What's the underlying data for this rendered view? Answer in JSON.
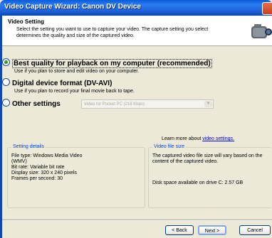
{
  "window": {
    "title": "Video Capture Wizard: Canon DV Device"
  },
  "header": {
    "title": "Video Setting",
    "description": "Select the setting you want to use to capture your video. The capture setting you select determines the quality and size of the captured video."
  },
  "options": [
    {
      "label": "Best quality for playback on my computer (recommended)",
      "description": "Use if you plan to store and edit video on your computer.",
      "selected": true
    },
    {
      "label": "Digital device format (DV-AVI)",
      "description": "Use if you plan to record your final movie back to tape.",
      "selected": false
    },
    {
      "label": "Other settings",
      "selected": false
    }
  ],
  "other_settings_select": {
    "value": "Video for Pocket PC (218 Kbps)"
  },
  "learn_more": {
    "prefix": "Learn more about ",
    "link": "video settings."
  },
  "setting_details": {
    "legend": "Setting details",
    "lines": [
      "File type: Windows Media Video",
      "(WMV)",
      "Bit rate: Variable bit rate",
      "Display size: 320 x 240 pixels",
      "Frames per second: 30"
    ]
  },
  "file_size": {
    "legend": "Video file size",
    "text": "The captured video file size will vary based on the content of the captured video.",
    "disk_space": "Disk space available on drive C: 2.57 GB"
  },
  "buttons": {
    "back": "< Back",
    "next": "Next >",
    "cancel": "Cancel"
  }
}
